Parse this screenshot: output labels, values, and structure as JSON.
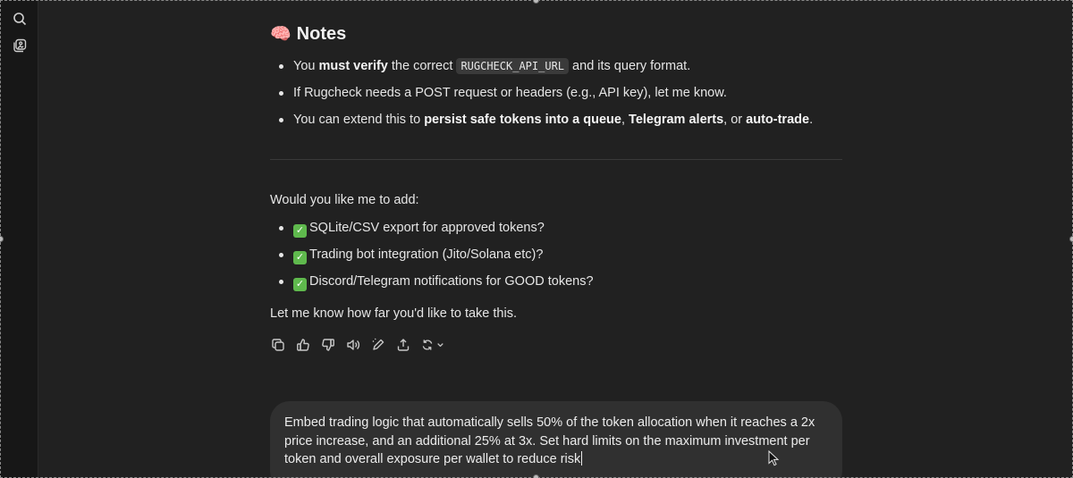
{
  "sidebar": {
    "items": [
      {
        "icon": "search-icon"
      },
      {
        "icon": "gallery-icon"
      }
    ]
  },
  "notes": {
    "emoji": "🧠",
    "title": "Notes",
    "bullet1": {
      "pre": "You ",
      "bold": "must verify",
      "mid": " the correct ",
      "code": "RUGCHECK_API_URL",
      "post": " and its query format."
    },
    "bullet2": "If Rugcheck needs a POST request or headers (e.g., API key), let me know.",
    "bullet3": {
      "pre": "You can extend this to ",
      "bold1": "persist safe tokens into a queue",
      "sep1": ", ",
      "bold2": "Telegram alerts",
      "sep2": ", or ",
      "bold3": "auto-trade",
      "post": "."
    }
  },
  "offer": {
    "intro": "Would you like me to add:",
    "items": [
      "SQLite/CSV export for approved tokens?",
      "Trading bot integration (Jito/Solana etc)?",
      "Discord/Telegram notifications for GOOD tokens?"
    ],
    "check_glyph": "✓",
    "outro": "Let me know how far you'd like to take this."
  },
  "actions": [
    "copy-icon",
    "thumbs-up-icon",
    "thumbs-down-icon",
    "read-aloud-icon",
    "edit-icon",
    "share-icon",
    "regenerate-icon"
  ],
  "composer": {
    "value": "Embed trading logic that automatically sells 50% of the token allocation when it reaches a 2x price increase, and an additional 25% at 3x. Set hard limits on the maximum investment per token and overall exposure per wallet to reduce risk"
  },
  "colors": {
    "background": "#212121",
    "sidebar": "#171717",
    "composer": "#303030",
    "check": "#5fb94d"
  }
}
